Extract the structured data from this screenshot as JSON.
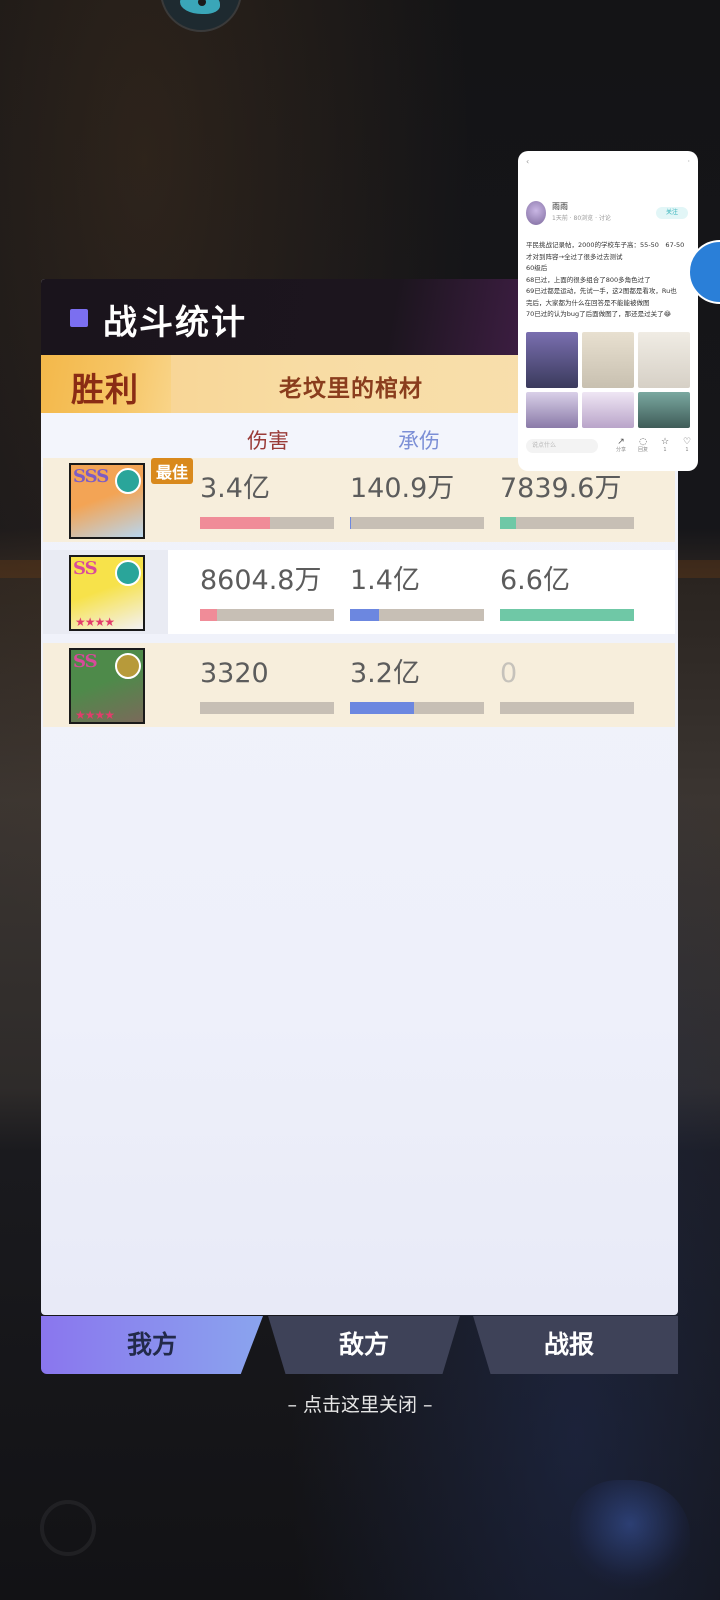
{
  "panel": {
    "title": "战斗统计",
    "result": "胜利",
    "player_name": "老坟里的棺材",
    "headers": {
      "damage": "伤害",
      "tank": "承伤"
    }
  },
  "best_tag": "最佳",
  "units": [
    {
      "rank": "SSS",
      "rank_color": "#7d5cc4",
      "element_icon": "wind-swirl-icon",
      "element_color": "#2aa59a",
      "portrait_colors": [
        "#f3a455",
        "#b8d6ef"
      ],
      "stars": "",
      "row_bg": "#f7eedc",
      "damage": {
        "text": "3.4亿",
        "fraction": 0.52,
        "color": "#f08c98"
      },
      "tank": {
        "text": "140.9万",
        "fraction": 0.01,
        "color": "#6c87e0"
      },
      "healing": {
        "text": "7839.6万",
        "fraction": 0.12,
        "color": "#6fc8a6"
      },
      "best": true
    },
    {
      "rank": "SS",
      "rank_color": "#d84a9a",
      "element_icon": "wind-swirl-icon",
      "element_color": "#2aa59a",
      "portrait_colors": [
        "#f7e24a",
        "#f3f1f4"
      ],
      "stars": "★★★★",
      "row_bg": "#ffffff",
      "damage": {
        "text": "8604.8万",
        "fraction": 0.13,
        "color": "#f08c98"
      },
      "tank": {
        "text": "1.4亿",
        "fraction": 0.22,
        "color": "#6c87e0"
      },
      "healing": {
        "text": "6.6亿",
        "fraction": 1.0,
        "color": "#6fc8a6"
      },
      "best": false
    },
    {
      "rank": "SS",
      "rank_color": "#d84a9a",
      "element_icon": "earth-cross-icon",
      "element_color": "#b79a3a",
      "portrait_colors": [
        "#4e8a4a",
        "#7a6a5a"
      ],
      "stars": "★★★★",
      "row_bg": "#f7eedc",
      "damage": {
        "text": "3320",
        "fraction": 0.0,
        "color": "#f08c98"
      },
      "tank": {
        "text": "3.2亿",
        "fraction": 0.48,
        "color": "#6c87e0"
      },
      "healing": {
        "text": "0",
        "fraction": 0.0,
        "color": "#6fc8a6"
      },
      "best": false
    }
  ],
  "tabs": {
    "ours": "我方",
    "enemy": "敌方",
    "report": "战报"
  },
  "close_hint": "– 点击这里关闭 –",
  "float_card": {
    "top_left": "‹",
    "top_right": "·",
    "user": "雨雨",
    "meta": "1天前 · 80浏览 · 讨论",
    "follow": "关注",
    "body_lines": [
      "平民挑战记录帖，2000的学校车子高：55-50　67-50",
      "才对到阵容→全过了很多过去测试",
      "60级后",
      "68已过，上面的很多组合了800多角色过了",
      "69已过都是运动，先试一手，这2图都是看攻，Ru也",
      "完后，大家都为什么在回答是不能能被做图",
      "70已过的认为bug了后面做图了，那还是过关了😂"
    ],
    "comment_placeholder": "说点什么",
    "actions": [
      {
        "icon": "share-icon",
        "count": "分享"
      },
      {
        "icon": "comment-icon",
        "count": "回复"
      },
      {
        "icon": "collect-icon",
        "count": "1"
      },
      {
        "icon": "like-icon",
        "count": "1"
      }
    ]
  }
}
